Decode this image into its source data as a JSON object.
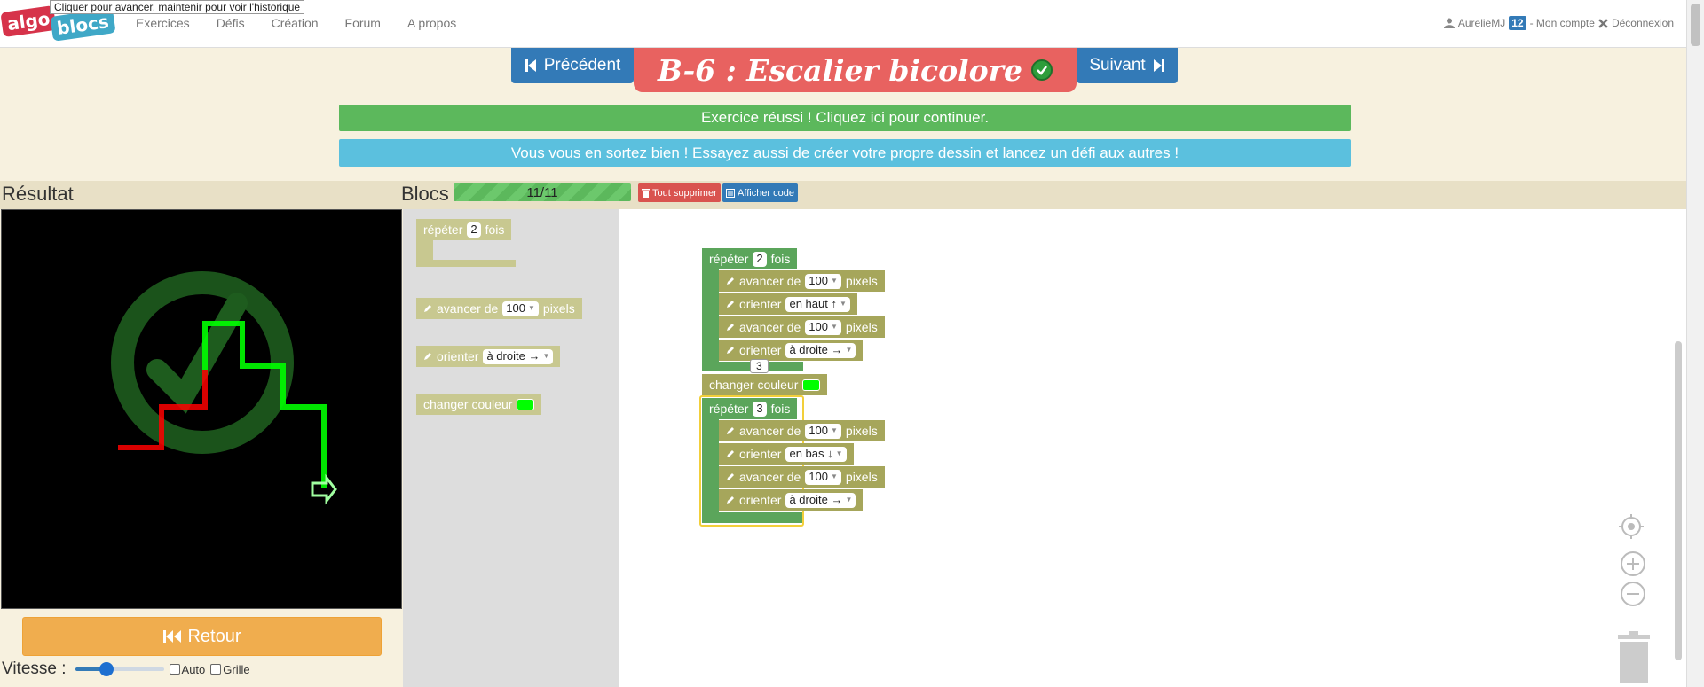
{
  "tooltip": "Cliquer pour avancer, maintenir pour voir l'historique",
  "logo": {
    "part1": "algo",
    "part2": "blocs"
  },
  "nav": {
    "links": [
      "Exercices",
      "Défis",
      "Création",
      "Forum",
      "A propos"
    ],
    "username": "AurelieMJ",
    "badge": "12",
    "account": "- Mon compte",
    "logout": "Déconnexion"
  },
  "header": {
    "prev": "Précédent",
    "next": "Suivant",
    "title": "B-6 : Escalier bicolore"
  },
  "alerts": {
    "success": "Exercice réussi ! Cliquez ici pour continuer.",
    "info": "Vous vous en sortez bien ! Essayez aussi de créer votre propre dessin et lancez un défi aux autres !"
  },
  "result": {
    "title": "Résultat",
    "retour": "Retour",
    "speed_label": "Vitesse :",
    "speed_value": 0.35,
    "auto_label": "Auto",
    "grid_label": "Grille"
  },
  "blocs": {
    "title": "Blocs",
    "progress": "11/11",
    "delete_all": "Tout supprimer",
    "show_code": "Afficher code"
  },
  "toolbox": {
    "repeat": {
      "label": "répéter",
      "count": "2",
      "suffix": "fois"
    },
    "forward": {
      "label": "avancer de",
      "value": "100",
      "suffix": "pixels"
    },
    "orient": {
      "label": "orienter",
      "value": "à droite →"
    },
    "color": {
      "label": "changer couleur",
      "color": "#00ff00"
    }
  },
  "program": {
    "repeat1": {
      "label": "répéter",
      "count": "2",
      "suffix": "fois"
    },
    "r1_forward1": {
      "label": "avancer de",
      "value": "100",
      "suffix": "pixels"
    },
    "r1_orient1": {
      "label": "orienter",
      "value": "en haut ↑"
    },
    "r1_forward2": {
      "label": "avancer de",
      "value": "100",
      "suffix": "pixels"
    },
    "r1_orient2": {
      "label": "orienter",
      "value": "à droite →"
    },
    "bubble": "3",
    "color": {
      "label": "changer couleur",
      "color": "#00ff00"
    },
    "repeat2": {
      "label": "répéter",
      "count": "3",
      "suffix": "fois"
    },
    "r2_forward1": {
      "label": "avancer de",
      "value": "100",
      "suffix": "pixels"
    },
    "r2_orient1": {
      "label": "orienter",
      "value": "en bas ↓"
    },
    "r2_forward2": {
      "label": "avancer de",
      "value": "100",
      "suffix": "pixels"
    },
    "r2_orient2": {
      "label": "orienter",
      "value": "à droite →"
    }
  },
  "colors": {
    "block_green": "#5ba55b",
    "block_olive": "#a6a65b",
    "line_red": "#ff0000",
    "line_green": "#00ff00",
    "success": "#5cb85c",
    "info": "#5bc0de",
    "primary": "#337ab7",
    "title_red": "#e86260"
  }
}
